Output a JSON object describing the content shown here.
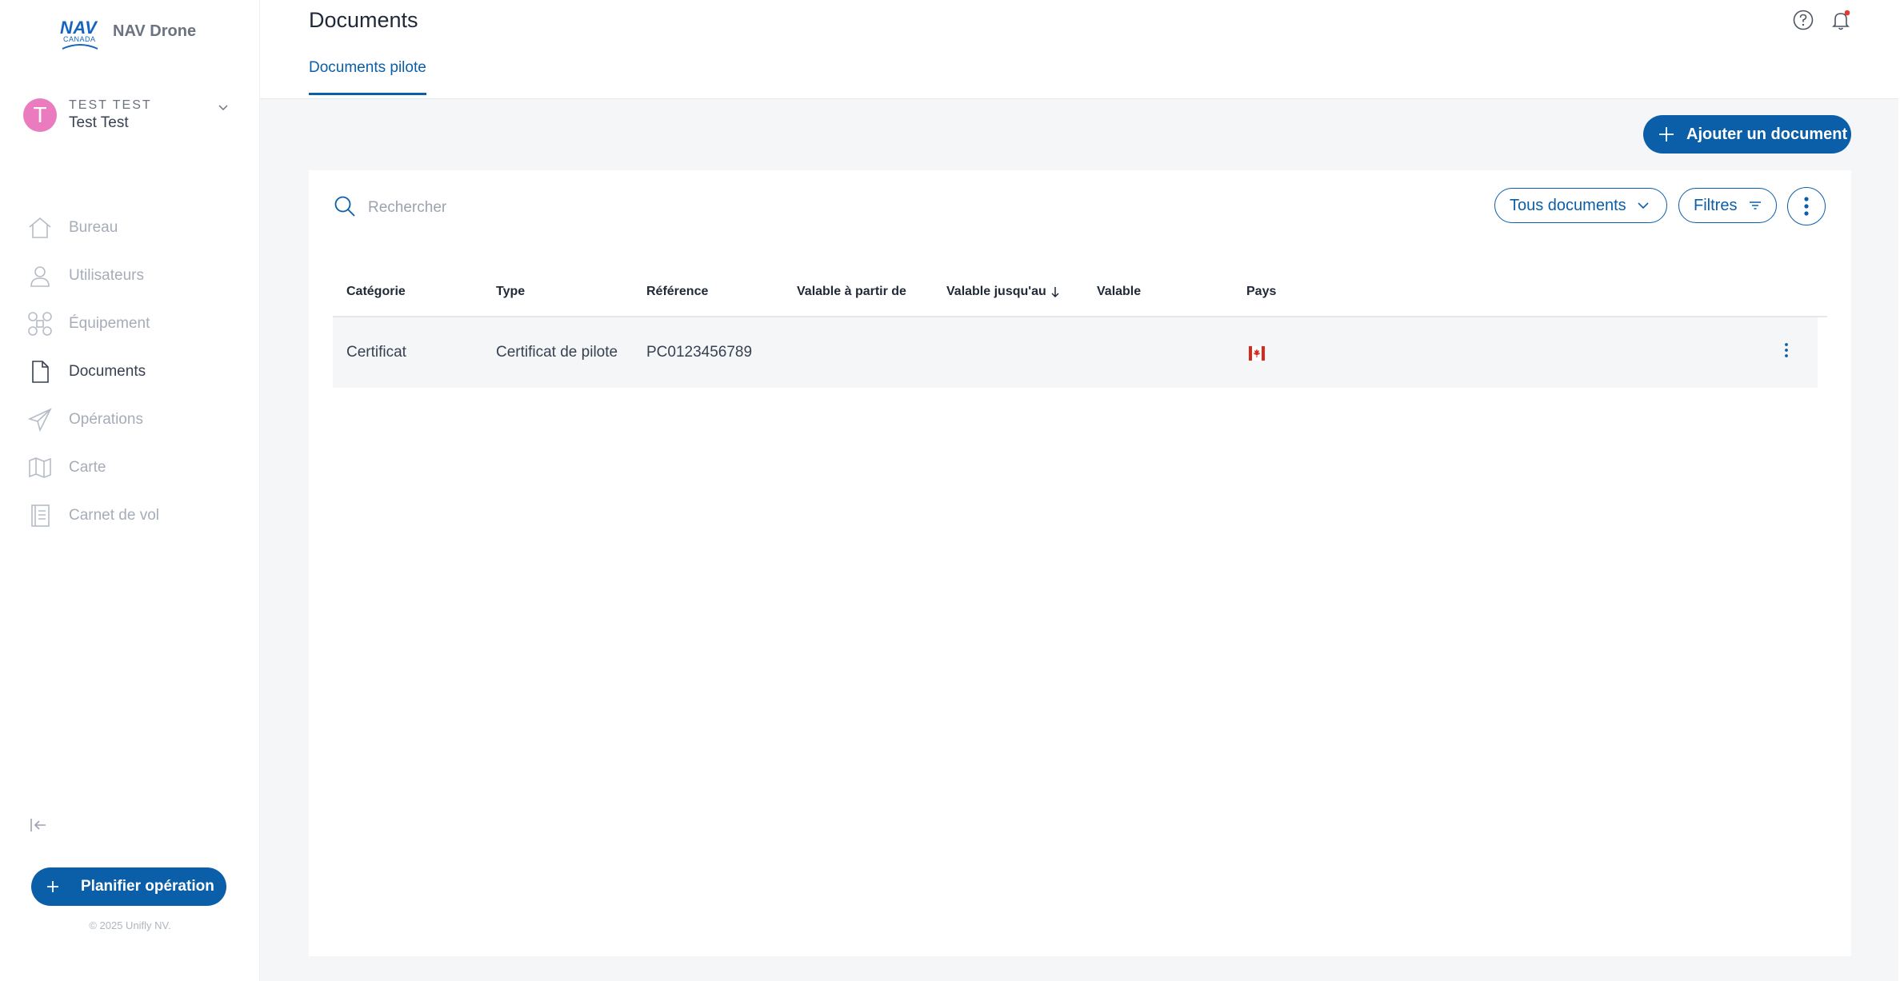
{
  "brand": {
    "logo_text": "NAV",
    "logo_sub": "CANADA",
    "app_name": "NAV Drone"
  },
  "user": {
    "initial": "T",
    "org": "TEST TEST",
    "name": "Test Test"
  },
  "nav": {
    "items": [
      {
        "label": "Bureau",
        "icon": "home-icon"
      },
      {
        "label": "Utilisateurs",
        "icon": "user-icon"
      },
      {
        "label": "Équipement",
        "icon": "drone-icon"
      },
      {
        "label": "Documents",
        "icon": "document-icon",
        "active": true
      },
      {
        "label": "Opérations",
        "icon": "paper-plane-icon"
      },
      {
        "label": "Carte",
        "icon": "map-icon"
      },
      {
        "label": "Carnet de vol",
        "icon": "logbook-icon"
      }
    ]
  },
  "sidebar_footer": {
    "plan_label": "Planifier opération",
    "copyright": "© 2025 Unifly NV."
  },
  "header": {
    "title": "Documents",
    "tab": "Documents pilote"
  },
  "toolbar": {
    "add_label": "Ajouter un document",
    "search_placeholder": "Rechercher",
    "docs_filter": "Tous documents",
    "filters_label": "Filtres"
  },
  "table": {
    "columns": [
      "Catégorie",
      "Type",
      "Référence",
      "Valable à partir de",
      "Valable jusqu'au",
      "Valable",
      "Pays"
    ],
    "sorted_column": "Valable jusqu'au",
    "sort_direction": "desc",
    "rows": [
      {
        "category": "Certificat",
        "type": "Certificat de pilote",
        "reference": "PC0123456789",
        "valid_from": "",
        "valid_until": "",
        "valid": "",
        "country_flag": "canada-flag-icon"
      }
    ]
  },
  "colors": {
    "primary": "#0b5ea8",
    "avatar": "#ea7bbf",
    "notification_dot": "#e53935",
    "background": "#f5f6f8"
  }
}
